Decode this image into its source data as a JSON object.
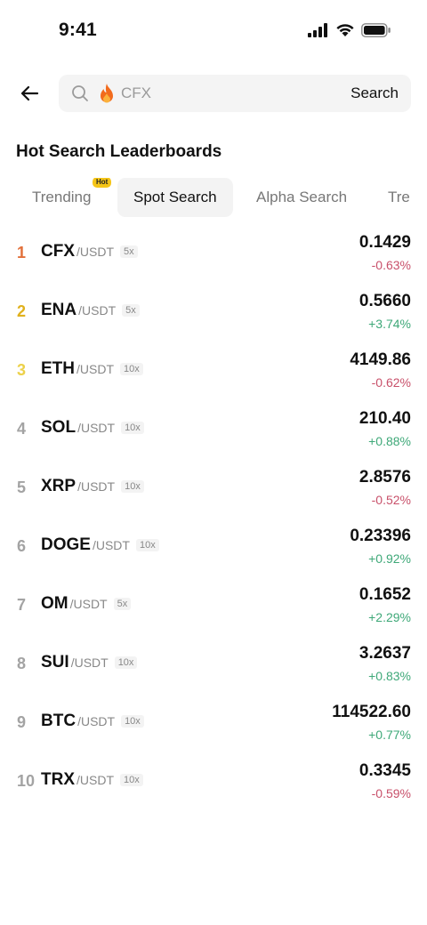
{
  "status_bar": {
    "time": "9:41"
  },
  "search": {
    "value": "",
    "placeholder": "CFX",
    "button_label": "Search"
  },
  "section": {
    "title": "Hot Search Leaderboards"
  },
  "tabs": [
    {
      "label": "Trending",
      "badge": "Hot",
      "active": false
    },
    {
      "label": "Spot Search",
      "active": true
    },
    {
      "label": "Alpha Search",
      "active": false
    },
    {
      "label": "Tre",
      "active": false
    }
  ],
  "colors": {
    "rank_1": "#e2703a",
    "rank_2": "#e0b11d",
    "rank_3": "#ecd14a",
    "rank_other": "#a3a3a3",
    "negative": "#c8506a",
    "positive": "#3ea878"
  },
  "rows": [
    {
      "rank": "1",
      "base": "CFX",
      "quote": "/USDT",
      "leverage": "5x",
      "price": "0.1429",
      "change": "-0.63%"
    },
    {
      "rank": "2",
      "base": "ENA",
      "quote": "/USDT",
      "leverage": "5x",
      "price": "0.5660",
      "change": "+3.74%"
    },
    {
      "rank": "3",
      "base": "ETH",
      "quote": "/USDT",
      "leverage": "10x",
      "price": "4149.86",
      "change": "-0.62%"
    },
    {
      "rank": "4",
      "base": "SOL",
      "quote": "/USDT",
      "leverage": "10x",
      "price": "210.40",
      "change": "+0.88%"
    },
    {
      "rank": "5",
      "base": "XRP",
      "quote": "/USDT",
      "leverage": "10x",
      "price": "2.8576",
      "change": "-0.52%"
    },
    {
      "rank": "6",
      "base": "DOGE",
      "quote": "/USDT",
      "leverage": "10x",
      "price": "0.23396",
      "change": "+0.92%"
    },
    {
      "rank": "7",
      "base": "OM",
      "quote": "/USDT",
      "leverage": "5x",
      "price": "0.1652",
      "change": "+2.29%"
    },
    {
      "rank": "8",
      "base": "SUI",
      "quote": "/USDT",
      "leverage": "10x",
      "price": "3.2637",
      "change": "+0.83%"
    },
    {
      "rank": "9",
      "base": "BTC",
      "quote": "/USDT",
      "leverage": "10x",
      "price": "114522.60",
      "change": "+0.77%"
    },
    {
      "rank": "10",
      "base": "TRX",
      "quote": "/USDT",
      "leverage": "10x",
      "price": "0.3345",
      "change": "-0.59%"
    }
  ]
}
